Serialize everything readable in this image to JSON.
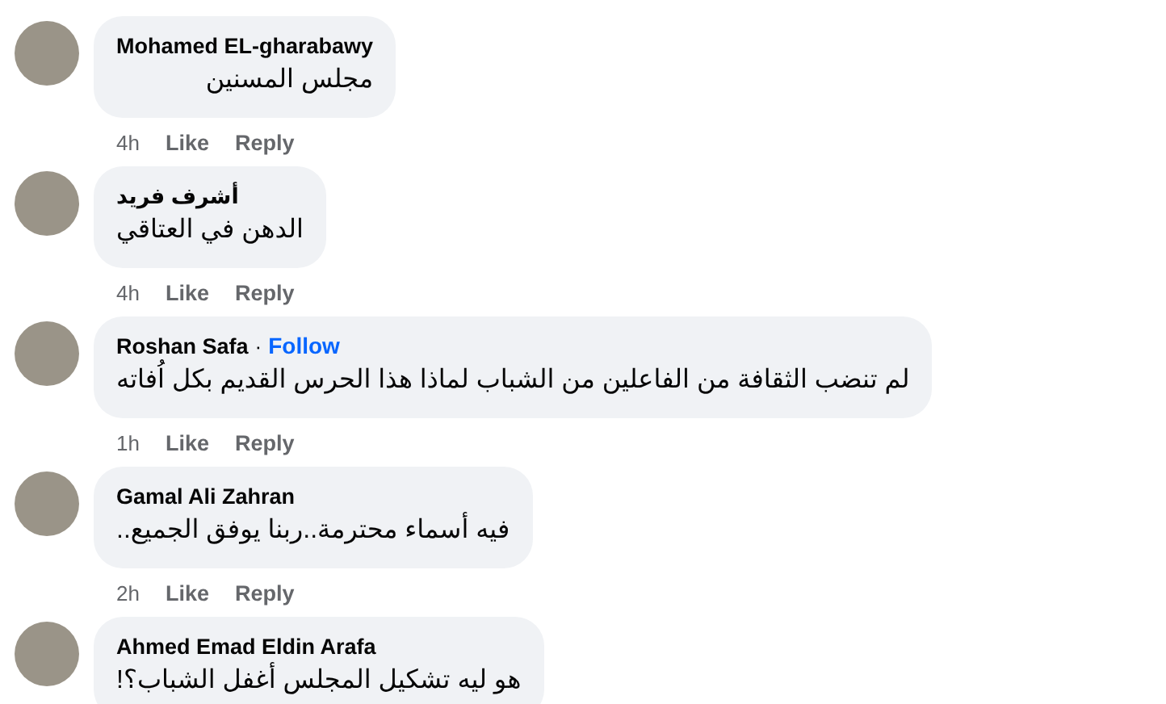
{
  "comments": [
    {
      "author": "Mohamed EL-gharabawy",
      "text": "مجلس المسنين",
      "time": "4h",
      "like": "Like",
      "reply": "Reply"
    },
    {
      "author": "أشرف فريد",
      "text": "الدهن في العتاقي",
      "time": "4h",
      "like": "Like",
      "reply": "Reply"
    },
    {
      "author": "Roshan Safa",
      "separator": "·",
      "follow": "Follow",
      "text": "لم تنضب الثقافة من الفاعلين من الشباب لماذا هذا الحرس القديم بكل اُفاته",
      "time": "1h",
      "like": "Like",
      "reply": "Reply"
    },
    {
      "author": "Gamal Ali Zahran",
      "text": "فيه أسماء محترمة..ربنا يوفق الجميع..",
      "time": "2h",
      "like": "Like",
      "reply": "Reply"
    },
    {
      "author": "Ahmed Emad Eldin Arafa",
      "text": "هو ليه تشكيل المجلس أغفل الشباب؟!"
    }
  ]
}
